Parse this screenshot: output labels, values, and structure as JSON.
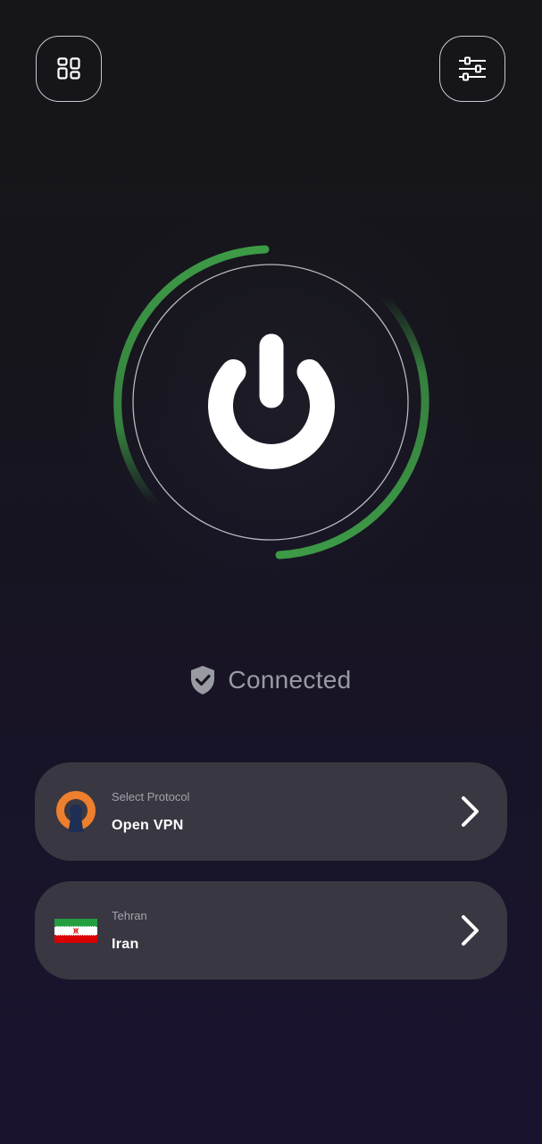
{
  "header": {
    "left_button_icon": "dashboard-grid-icon",
    "right_button_icon": "settings-sliders-icon"
  },
  "power": {
    "icon": "power-icon",
    "connected": true,
    "accent_color": "#3d9a46"
  },
  "status": {
    "icon": "shield-check-icon",
    "text": "Connected"
  },
  "protocol_card": {
    "label": "Select Protocol",
    "value": "Open VPN",
    "icon": "openvpn-logo-icon",
    "chevron": "chevron-right-icon"
  },
  "location_card": {
    "label": "Tehran",
    "value": "Iran",
    "icon": "iran-flag-icon",
    "chevron": "chevron-right-icon"
  },
  "colors": {
    "card_background": "#393842",
    "openvpn_orange": "#ee7f2d",
    "openvpn_navy": "#1d2f55",
    "flag_green": "#239f40",
    "flag_white": "#ffffff",
    "flag_red": "#da0000"
  }
}
